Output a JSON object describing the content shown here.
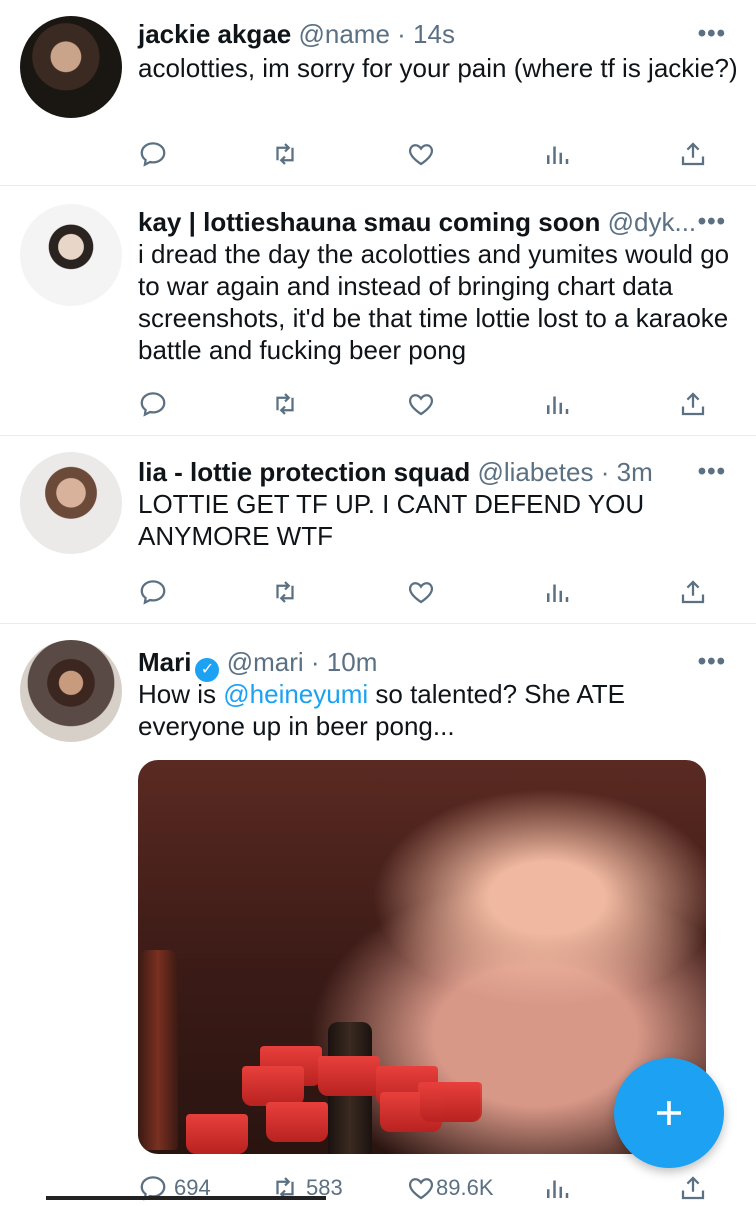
{
  "tweets": [
    {
      "name": "jackie akgae",
      "handle": "@name",
      "time": "14s",
      "text": "acolotties, im sorry for your pain (where tf is jackie?)"
    },
    {
      "name": "kay | lottieshauna smau coming soon",
      "handle": "@dyk...",
      "time": "",
      "text": "i dread the day the acolotties and yumites would go to war again and instead of bringing chart data screenshots, it'd be that time lottie lost to a karaoke battle and fucking beer pong"
    },
    {
      "name": "lia - lottie protection squad",
      "handle": "@liabetes",
      "time": "3m",
      "text": "LOTTIE GET TF UP. I CANT DEFEND YOU ANYMORE WTF"
    },
    {
      "name": "Mari",
      "handle": "@mari",
      "time": "10m",
      "text_pre": "How is ",
      "mention": "@heineyumi",
      "text_post": " so talented? She ATE everyone up in beer pong...",
      "replies": "694",
      "retweets": "583",
      "likes": "89.6K"
    }
  ],
  "separator": "·",
  "more_glyph": "•••",
  "colors": {
    "accent": "#1da1f2",
    "secondary": "#5b7083"
  },
  "icons": [
    "reply-icon",
    "retweet-icon",
    "like-icon",
    "analytics-icon",
    "share-icon",
    "more-icon",
    "verified-icon",
    "compose-plus-icon"
  ]
}
